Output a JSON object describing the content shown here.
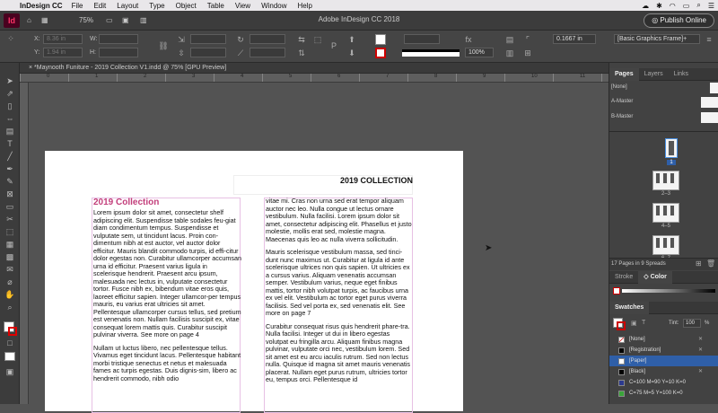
{
  "menubar": {
    "apple": "",
    "app": "InDesign CC",
    "menus": [
      "File",
      "Edit",
      "Layout",
      "Type",
      "Object",
      "Table",
      "View",
      "Window",
      "Help"
    ]
  },
  "appbar": {
    "logo": "Id",
    "home": "⌂",
    "zoom": "75%",
    "title": "Adobe InDesign CC 2018",
    "publish": "Publish Online"
  },
  "control": {
    "x_label": "X:",
    "x_value": "8.36 in",
    "y_label": "Y:",
    "y_value": "1.94 in",
    "w_label": "W:",
    "h_label": "H:",
    "stroke_weight": "0.1667 in",
    "percent": "100%",
    "frame_style": "[Basic Graphics Frame]+"
  },
  "document": {
    "tab": "*Maynooth Funiture - 2019 Collection V1.indd @ 75% [GPU Preview]",
    "header": "2019 COLLECTION",
    "title": "2019 Collection",
    "left_p1": "Lorem ipsum dolor sit amet, consectetur shelf adipiscing elit. Suspendisse table sodales feu-giat diam condimentum tempus. Suspendisse et vulputate sem, ut tincidunt lacus. Proin con-dimentum nibh at est auctor, vel auctor dolor efficitur. Mauris blandit commodo turpis, id effi-citur dolor egestas non. Curabitur ullamcorper accumsan urna id efficitur. Praesent varius ligula in scelerisque hendrerit. Praesent arcu ipsum, malesuada nec lectus in, vulputate consectetur tortor. Fusce nibh ex, bibendum vitae eros quis, laoreet efficitur sapien. Integer ullamcor-per tempus mauris, eu varius erat ultricies sit amet. Pellentesque ullamcorper cursus tellus, sed pretium est venenatis non. Nullam facilisis suscipit ex, vitae consequat lorem mattis quis. Curabitur suscipit pulvinar viverra. See more on page 4",
    "left_p2": "Nullam ut luctus libero, nec pellentesque tellus. Vivamus eget tincidunt lacus. Pellentesque habitant morbi tristique senectus et netus et malesuada fames ac turpis egestas. Duis dignis-sim, libero ac hendrerit commodo, nibh odio",
    "right_p1": "vitae mi. Cras non urna sed erat tempor aliquam auctor nec leo. Nulla congue ut lectus ornare vestibulum. Nulla facilisi. Lorem ipsum dolor sit amet, consectetur adipiscing elit. Phasellus et justo molestie, mollis erat sed, molestie magna. Maecenas quis leo ac nulla viverra sollicitudin.",
    "right_p2": "Mauris scelerisque vestibulum massa, sed tinci-dunt nunc maximus ut. Curabitur at ligula id ante scelerisque ultrices non quis sapien. Ut ultricies ex a cursus varius. Aliquam venenatis accumsan semper. Vestibulum varius, neque eget finibus mattis, tortor nibh volutpat turpis, ac faucibus urna ex vel elit. Vestibulum ac tortor eget purus viverra facilisis. Sed vel porta ex, sed venenatis elit. See more on page 7",
    "right_p3": "Curabitur consequat risus quis hendrerit phare-tra. Nulla facilisi. Integer ut dui in libero egestas volutpat eu fringilla arcu. Aliquam finibus magna pulvinar, vulputate orci nec, vestibulum lorem. Sed sit amet est eu arcu iaculis rutrum. Sed non lectus nulla. Quisque id magna sit amet mauris venenatis placerat. Nullam eget purus rutrum, ultricies tortor eu, tempus orci. Pellentesque id"
  },
  "ruler": {
    "numbers": [
      "0",
      "1",
      "2",
      "3",
      "4",
      "5",
      "6",
      "7",
      "8",
      "9",
      "10",
      "11"
    ]
  },
  "pages_panel": {
    "tabs": [
      "Pages",
      "Layers",
      "Links"
    ],
    "none": "[None]",
    "masters": [
      "A-Master",
      "B-Master"
    ],
    "spread_labels": [
      "1",
      "2–3",
      "4–5",
      "6–7"
    ],
    "footer": "17 Pages in 9 Spreads"
  },
  "stroke_panel": {
    "tabs": [
      "Stroke",
      "Color"
    ]
  },
  "swatches_panel": {
    "tab": "Swatches",
    "tint_label": "Tint:",
    "tint_value": "100",
    "percent": "%",
    "items": [
      {
        "name": "[None]",
        "color": "#ffffff"
      },
      {
        "name": "[Registration]",
        "color": "#000000"
      },
      {
        "name": "[Paper]",
        "color": "#ffffff"
      },
      {
        "name": "[Black]",
        "color": "#000000"
      },
      {
        "name": "C=100 M=90 Y=10 K=0",
        "color": "#2c3a8f"
      },
      {
        "name": "C=75 M=5 Y=100 K=0",
        "color": "#3aa43a"
      }
    ]
  },
  "colors": {
    "accent_pink": "#c23d7a",
    "frame_guide": "#e7c0e4",
    "paper_selected": "#2f5fa8"
  }
}
